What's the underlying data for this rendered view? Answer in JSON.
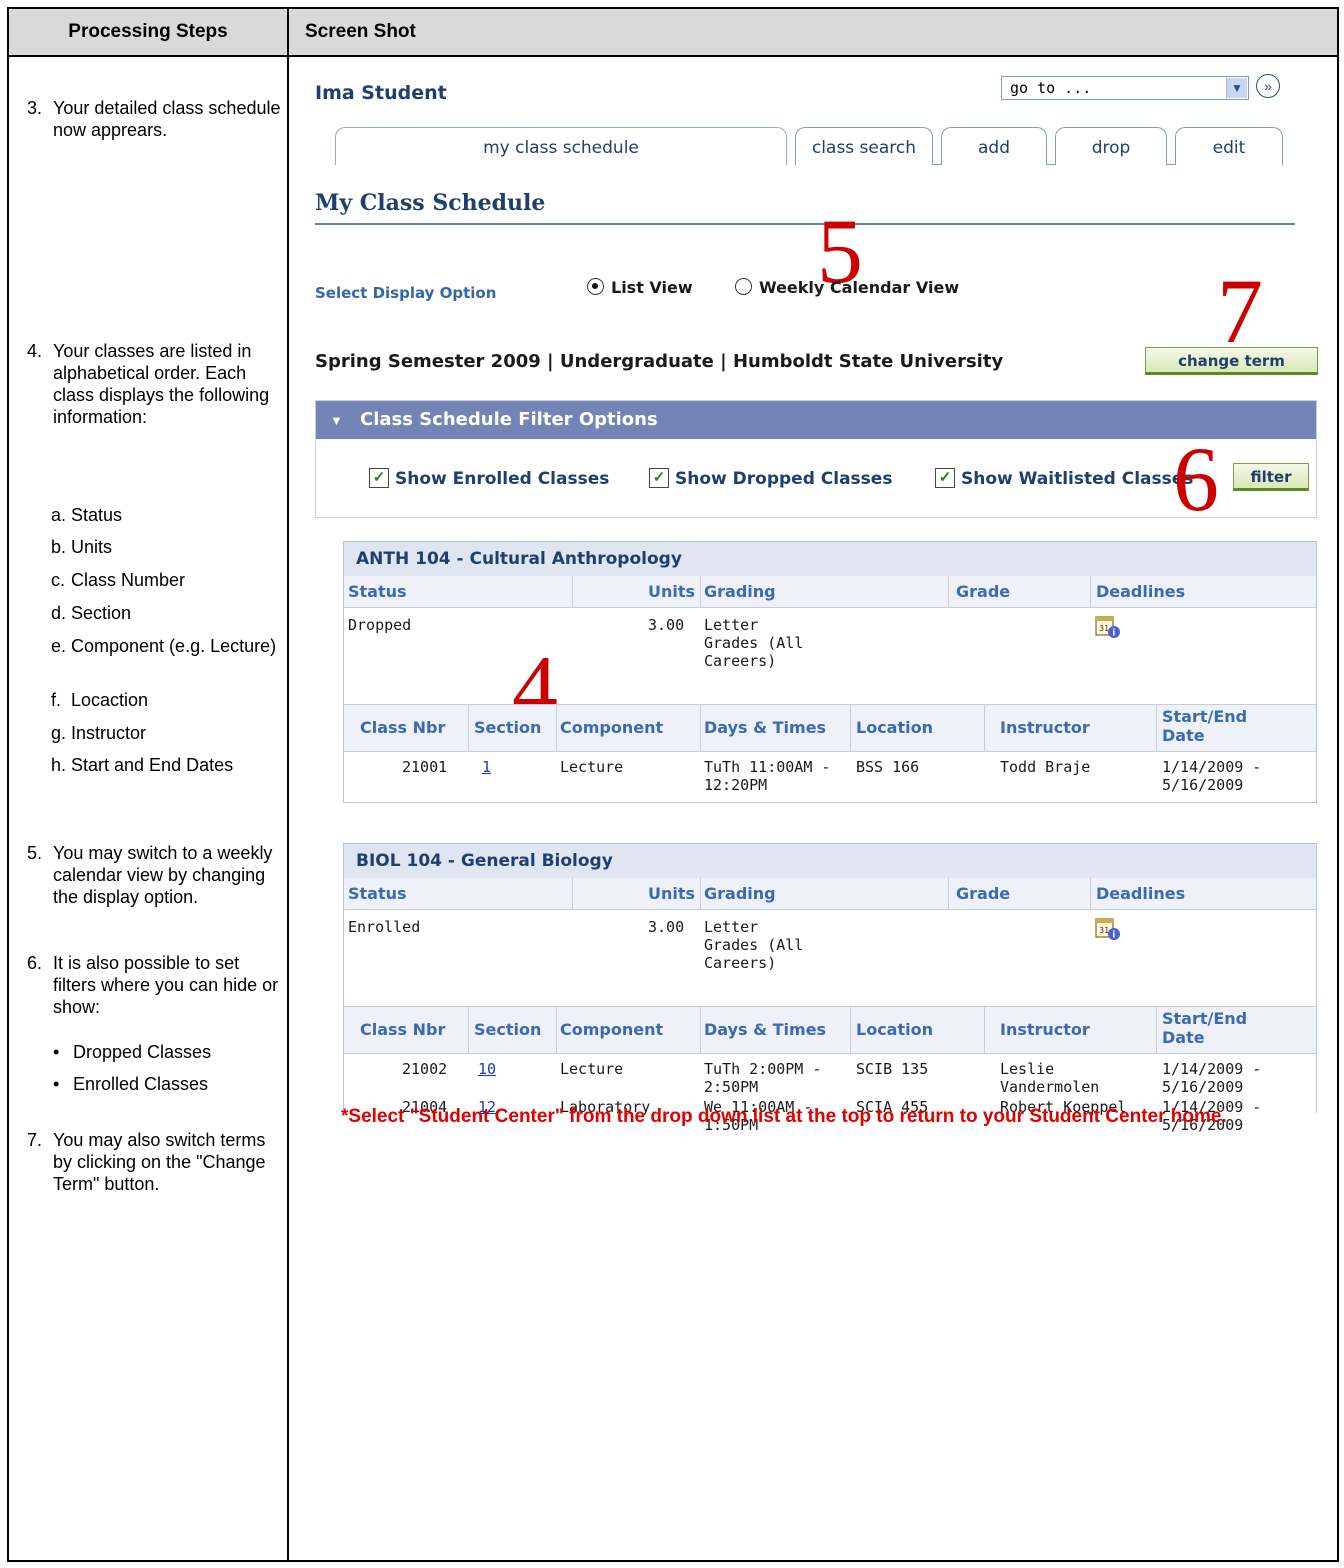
{
  "header": {
    "col1": "Processing Steps",
    "col2": "Screen Shot"
  },
  "steps": [
    {
      "num": "3.",
      "text": "Your detailed class schedule now apprears."
    },
    {
      "num": "4.",
      "text": "Your classes are listed in alphabetical order. Each class displays the following information:"
    },
    {
      "num": "5.",
      "text": "You may switch to a weekly calendar view by changing the display option."
    },
    {
      "num": "6.",
      "text": "It is also possible to set filters where you can hide or show:"
    },
    {
      "num": "7.",
      "text": "You may also switch terms by clicking on the \"Change Term\" button."
    }
  ],
  "sub_items": [
    {
      "letter": "a.",
      "text": "Status"
    },
    {
      "letter": "b.",
      "text": "Units"
    },
    {
      "letter": "c.",
      "text": "Class Number"
    },
    {
      "letter": "d.",
      "text": "Section"
    },
    {
      "letter": "e.",
      "text": "Component (e.g. Lecture)"
    },
    {
      "letter": "f.",
      "text": "Locaction"
    },
    {
      "letter": "g.",
      "text": "Instructor"
    },
    {
      "letter": "h.",
      "text": "Start and End Dates"
    }
  ],
  "bullets": [
    "Dropped Classes",
    "Enrolled Classes"
  ],
  "screenshot": {
    "student_name": "Ima Student",
    "goto_value": "go to ...",
    "tabs": [
      "my class schedule",
      "class search",
      "add",
      "drop",
      "edit"
    ],
    "page_title": "My Class Schedule",
    "display_option_label": "Select Display Option",
    "radio_list": "List View",
    "radio_weekly": "Weekly Calendar View",
    "term_text": "Spring Semester 2009 | Undergraduate | Humboldt State University",
    "change_term_label": "change term",
    "filter_title": "Class Schedule Filter Options",
    "filter_enrolled": "Show Enrolled Classes",
    "filter_dropped": "Show Dropped Classes",
    "filter_waitlisted": "Show Waitlisted Classes",
    "filter_button": "filter",
    "annotations": {
      "n4": "4",
      "n5": "5",
      "n6": "6",
      "n7": "7"
    },
    "status_headers": [
      "Status",
      "Units",
      "Grading",
      "Grade",
      "Deadlines"
    ],
    "section_headers": [
      "Class Nbr",
      "Section",
      "Component",
      "Days & Times",
      "Location",
      "Instructor",
      "Start/End Date"
    ],
    "classes": [
      {
        "title": "ANTH 104 - Cultural Anthropology",
        "status": "Dropped",
        "units": "3.00",
        "grading": "Letter Grades (All Careers)",
        "sections": [
          {
            "nbr": "21001",
            "section": "1",
            "component": "Lecture",
            "days": "TuTh 11:00AM - 12:20PM",
            "location": "BSS 166",
            "instructor": "Todd Braje",
            "dates": "1/14/2009 - 5/16/2009"
          }
        ]
      },
      {
        "title": "BIOL 104 - General Biology",
        "status": "Enrolled",
        "units": "3.00",
        "grading": "Letter Grades (All Careers)",
        "sections": [
          {
            "nbr": "21002",
            "section": "10",
            "component": "Lecture",
            "days": "TuTh 2:00PM - 2:50PM",
            "location": "SCIB 135",
            "instructor": "Leslie Vandermolen",
            "dates": "1/14/2009 - 5/16/2009"
          },
          {
            "nbr": "21004",
            "section": "12",
            "component": "Laboratory",
            "days": "We 11:00AM - 1:50PM",
            "location": "SCIA 455",
            "instructor": "Robert Koeppel",
            "dates": "1/14/2009 - 5/16/2009"
          }
        ]
      }
    ],
    "note": "*Select \"Student Center\" from the drop down list at the top to return to your Student Center home."
  }
}
